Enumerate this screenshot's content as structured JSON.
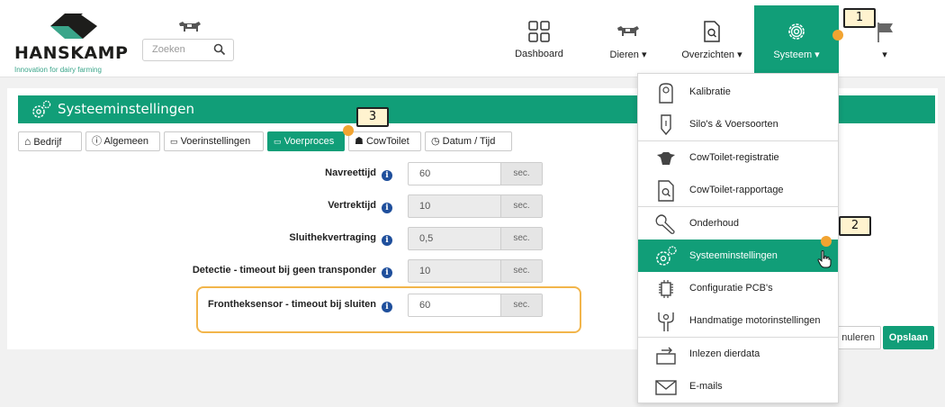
{
  "brand": {
    "name": "HANSKAMP",
    "tagline": "Innovation for dairy farming"
  },
  "search": {
    "placeholder": "Zoeken"
  },
  "nav": [
    {
      "label": "Dashboard",
      "icon": "dashboard-icon"
    },
    {
      "label": "Dieren ▾",
      "icon": "cow-icon"
    },
    {
      "label": "Overzichten ▾",
      "icon": "report-icon"
    },
    {
      "label": "Systeem ▾",
      "icon": "gear-icon"
    },
    {
      "label": "▾",
      "icon": "flag-icon"
    }
  ],
  "page": {
    "title": "Systeeminstellingen"
  },
  "tabs": [
    {
      "label": "Bedrijf",
      "icon": "home-icon"
    },
    {
      "label": "Algemeen",
      "icon": "info-circle-icon"
    },
    {
      "label": "Voerinstellingen",
      "icon": "feed-icon"
    },
    {
      "label": "Voerproces",
      "icon": "feed-process-icon",
      "active": true
    },
    {
      "label": "CowToilet",
      "icon": "cowtoilet-icon"
    },
    {
      "label": "Datum / Tijd",
      "icon": "clock-icon"
    }
  ],
  "settings": [
    {
      "label": "Navreettijd",
      "value": "60",
      "unit": "sec.",
      "readonly": false
    },
    {
      "label": "Vertrektijd",
      "value": "10",
      "unit": "sec.",
      "readonly": true
    },
    {
      "label": "Sluithekvertraging",
      "value": "0,5",
      "unit": "sec.",
      "readonly": true
    },
    {
      "label": "Detectie - timeout bij geen transponder",
      "value": "10",
      "unit": "sec.",
      "readonly": true
    },
    {
      "label": "Frontheksensor - timeout bij sluiten",
      "value": "60",
      "unit": "sec.",
      "readonly": false
    }
  ],
  "buttons": {
    "cancel": "nuleren",
    "save": "Opslaan"
  },
  "menu": [
    {
      "label": "Kalibratie",
      "icon": "scale-icon"
    },
    {
      "label": "Silo's & Voersoorten",
      "icon": "silo-icon"
    },
    {
      "label": "CowToilet-registratie",
      "icon": "cow-head-icon"
    },
    {
      "label": "CowToilet-rapportage",
      "icon": "report-icon"
    },
    {
      "label": "Onderhoud",
      "icon": "wrench-icon"
    },
    {
      "label": "Systeeminstellingen",
      "icon": "gears-icon",
      "active": true
    },
    {
      "label": "Configuratie PCB's",
      "icon": "chip-icon"
    },
    {
      "label": "Handmatige motorinstellingen",
      "icon": "motor-icon"
    },
    {
      "label": "Inlezen dierdata",
      "icon": "import-icon"
    },
    {
      "label": "E-mails",
      "icon": "mail-icon"
    }
  ],
  "callouts": [
    "1",
    "2",
    "3"
  ],
  "colors": {
    "brand_green": "#119e78",
    "highlight": "#f2b54b",
    "info_blue": "#1f4f9c"
  }
}
